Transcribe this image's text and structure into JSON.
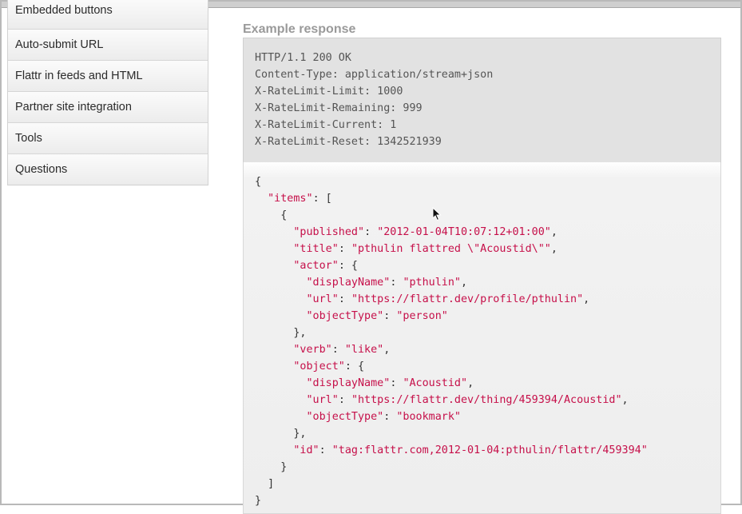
{
  "sidebar": {
    "items": [
      {
        "label": "Embedded buttons"
      },
      {
        "label": "Auto-submit URL"
      },
      {
        "label": "Flattr in feeds and HTML"
      },
      {
        "label": "Partner site integration"
      },
      {
        "label": "Tools"
      },
      {
        "label": "Questions"
      }
    ]
  },
  "main": {
    "heading": "Example response",
    "headers": [
      "HTTP/1.1 200 OK",
      "Content-Type: application/stream+json",
      "X-RateLimit-Limit: 1000",
      "X-RateLimit-Remaining: 999",
      "X-RateLimit-Current: 1",
      "X-RateLimit-Reset: 1342521939"
    ],
    "json": {
      "open_brace": "{",
      "items_key": "\"items\"",
      "item_open": "{",
      "published_key": "\"published\"",
      "published_val": "\"2012-01-04T10:07:12+01:00\"",
      "title_key": "\"title\"",
      "title_val": "\"pthulin flattred \\\"Acoustid\\\"\"",
      "actor_key": "\"actor\"",
      "actor_display_key": "\"displayName\"",
      "actor_display_val": "\"pthulin\"",
      "actor_url_key": "\"url\"",
      "actor_url_val": "\"https://flattr.dev/profile/pthulin\"",
      "actor_type_key": "\"objectType\"",
      "actor_type_val": "\"person\"",
      "verb_key": "\"verb\"",
      "verb_val": "\"like\"",
      "object_key": "\"object\"",
      "object_display_key": "\"displayName\"",
      "object_display_val": "\"Acoustid\"",
      "object_url_key": "\"url\"",
      "object_url_val": "\"https://flattr.dev/thing/459394/Acoustid\"",
      "object_type_key": "\"objectType\"",
      "object_type_val": "\"bookmark\"",
      "id_key": "\"id\"",
      "id_val": "\"tag:flattr.com,2012-01-04:pthulin/flattr/459394\"",
      "item_close": "}",
      "array_close": "]",
      "close_brace": "}"
    }
  }
}
